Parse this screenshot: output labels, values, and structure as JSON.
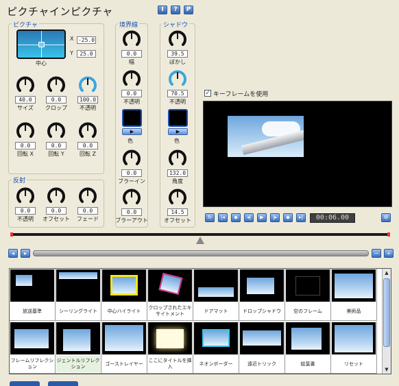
{
  "header": {
    "title": "ピクチャインピクチャ",
    "btn_info": "I",
    "btn_help": "?",
    "btn_p": "P"
  },
  "picture": {
    "label": "ピクチャ",
    "x_label": "X",
    "x_value": "-25.0",
    "y_label": "Y",
    "y_value": "25.0",
    "center_label": "中心",
    "knobs": [
      {
        "value": "40.0",
        "label": "サイズ"
      },
      {
        "value": "0.0",
        "label": "クロップ"
      },
      {
        "value": "100.0",
        "label": "不透明"
      },
      {
        "value": "0.0",
        "label": "回転 X"
      },
      {
        "value": "0.0",
        "label": "回転 Y"
      },
      {
        "value": "0.0",
        "label": "回転 Z"
      }
    ]
  },
  "reflection": {
    "label": "反射",
    "knobs": [
      {
        "value": "0.0",
        "label": "不透明"
      },
      {
        "value": "0.0",
        "label": "オフセット"
      },
      {
        "value": "0.0",
        "label": "フェード"
      }
    ]
  },
  "border": {
    "label": "境界線",
    "knobs": [
      {
        "value": "0.0",
        "label": "幅"
      },
      {
        "value": "0.0",
        "label": "不透明"
      },
      {
        "value": "0.0",
        "label": "ブラーイン"
      },
      {
        "value": "0.0",
        "label": "ブラーアウト"
      }
    ],
    "color_label": "色"
  },
  "shadow": {
    "label": "シャドウ",
    "knobs": [
      {
        "value": "39.5",
        "label": "ぼかし"
      },
      {
        "value": "70.5",
        "label": "不透明"
      },
      {
        "value": "132.0",
        "label": "角度"
      },
      {
        "value": "14.5",
        "label": "オフセット"
      }
    ],
    "color_label": "色"
  },
  "keyframe": {
    "label": "キーフレームを使用",
    "checked": true
  },
  "transport": {
    "timecode": "00:06.00"
  },
  "gallery": {
    "items": [
      {
        "label": "放送基準"
      },
      {
        "label": "シーリングライト"
      },
      {
        "label": "中心ハイライト"
      },
      {
        "label": "クロップされたエキサイトメント"
      },
      {
        "label": "ドアマット"
      },
      {
        "label": "ドロップシャドウ"
      },
      {
        "label": "空のフレーム"
      },
      {
        "label": "美術品"
      },
      {
        "label": "フレームリフレクション"
      },
      {
        "label": "ジェントルリフレクション"
      },
      {
        "label": "ゴーストレイヤー"
      },
      {
        "label": "ここにタイトルを挿入"
      },
      {
        "label": "ネオンボーダー"
      },
      {
        "label": "遠近トリック"
      },
      {
        "label": "絵葉書"
      },
      {
        "label": "リセット"
      }
    ]
  },
  "colors": {
    "accent": "#1b4fb6",
    "knob_arc": "#111111",
    "knob_arc_hi": "#3aa7dd"
  }
}
